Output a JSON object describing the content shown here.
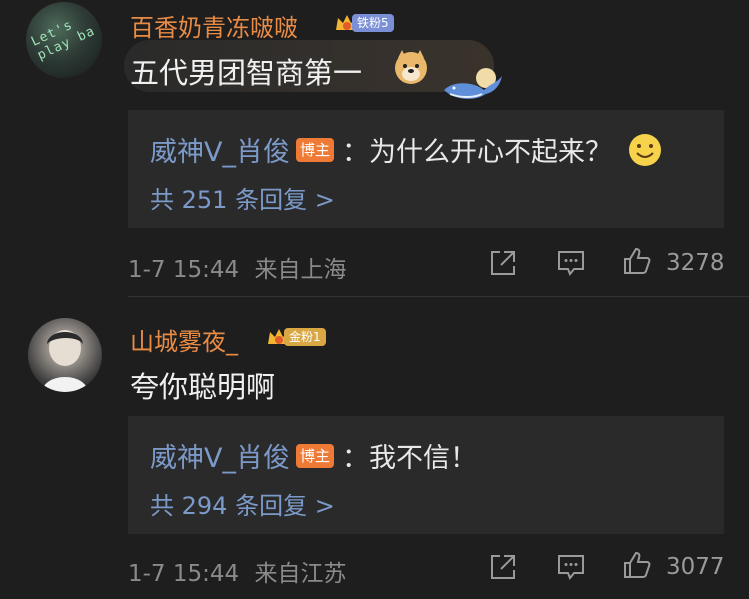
{
  "comments": [
    {
      "username": "百香奶青冻啵啵",
      "badge": "铁粉5",
      "avatar_text": "Let's play ba",
      "text": "五代男团智商第一",
      "reply": {
        "author": "威神V_肖俊",
        "author_tag": "博主",
        "text": "：为什么开心不起来？",
        "count_label": "共 251 条回复 >"
      },
      "meta": {
        "time": "1-7 15:44",
        "location": "来自上海",
        "likes": "3278"
      }
    },
    {
      "username": "山城雾夜_",
      "badge": "金粉1",
      "text": "夸你聪明啊",
      "reply": {
        "author": "威神V_肖俊",
        "author_tag": "博主",
        "text": "：我不信！",
        "count_label": "共 294 条回复 >"
      },
      "meta": {
        "time": "1-7 15:44",
        "location": "来自江苏",
        "likes": "3077"
      }
    }
  ],
  "colors": {
    "background": "#1e1e1e",
    "username": "#e88b45",
    "reply_link": "#7c9ac9",
    "host_tag": "#ee7a35",
    "meta": "#8a8a8a"
  },
  "icons": [
    "crown-badge-icon",
    "doge-emoji-icon",
    "whale-decoration-icon",
    "smiley-emoji-icon",
    "share-icon",
    "comment-icon",
    "like-icon"
  ]
}
